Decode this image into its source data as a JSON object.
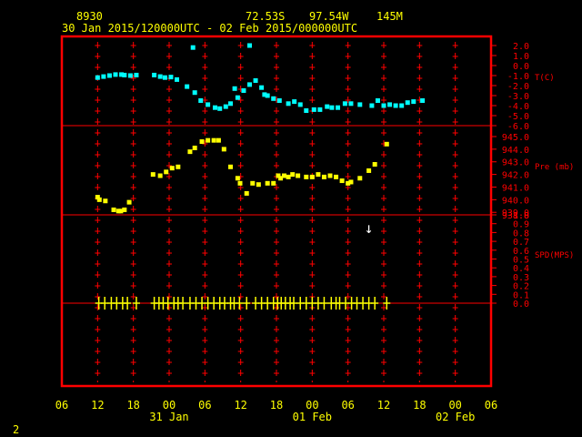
{
  "header": {
    "station_id": "8930",
    "latitude": "72.53S",
    "longitude": "97.54W",
    "elevation": "145M",
    "time_range": "30 Jan 2015/120000UTC - 02 Feb 2015/000000UTC"
  },
  "footer": {
    "page_number": "2",
    "time_tick_labels": [
      "06",
      "12",
      "18",
      "00",
      "06",
      "12",
      "18",
      "00",
      "06",
      "12",
      "18",
      "00",
      "06"
    ],
    "date_labels": [
      "31 Jan",
      "01 Feb",
      "02 Feb"
    ]
  },
  "colors": {
    "frame": "#ff0000",
    "temperature": "#00ffff",
    "pressure": "#ffff00",
    "wind": "#ffff00",
    "grid": "#ff0000",
    "wind_arrow": "#ffffff",
    "text": "#ffff00",
    "axis_text": "#ff0000"
  },
  "chart_data": {
    "type": "scatter",
    "x_axis": {
      "units": "hours since 30 Jan 2015 06 UTC",
      "range": [
        0,
        72
      ],
      "tick_labels": [
        "06",
        "12",
        "18",
        "00",
        "06",
        "12",
        "18",
        "00",
        "06",
        "12",
        "18",
        "00",
        "06"
      ]
    },
    "panels": [
      {
        "name": "temperature",
        "ylabel": "T(C)",
        "y_ticks": [
          "2.0",
          "1.0",
          "0.0",
          "-1.0",
          "-2.0",
          "-3.0",
          "-4.0",
          "-5.0",
          "-6.0"
        ],
        "ylim": [
          -6,
          2
        ],
        "points": [
          [
            6.0,
            -1.2
          ],
          [
            7.0,
            -1.1
          ],
          [
            8.0,
            -1.0
          ],
          [
            9.0,
            -0.9
          ],
          [
            10.0,
            -0.9
          ],
          [
            10.5,
            -0.95
          ],
          [
            11.5,
            -1.0
          ],
          [
            12.5,
            -0.95
          ],
          [
            15.5,
            -0.95
          ],
          [
            16.5,
            -1.1
          ],
          [
            17.3,
            -1.2
          ],
          [
            18.3,
            -1.15
          ],
          [
            19.3,
            -1.4
          ],
          [
            21.0,
            -2.1
          ],
          [
            22.3,
            -2.7
          ],
          [
            23.3,
            -3.5
          ],
          [
            24.5,
            -3.9
          ],
          [
            25.7,
            -4.2
          ],
          [
            26.5,
            -4.3
          ],
          [
            27.5,
            -4.1
          ],
          [
            28.3,
            -3.8
          ],
          [
            29.0,
            -2.3
          ],
          [
            29.5,
            -3.2
          ],
          [
            30.5,
            -2.5
          ],
          [
            31.5,
            -1.9
          ],
          [
            32.5,
            -1.5
          ],
          [
            33.5,
            -2.2
          ],
          [
            34.0,
            -2.9
          ],
          [
            34.5,
            -3.0
          ],
          [
            35.5,
            -3.3
          ],
          [
            36.5,
            -3.5
          ],
          [
            38.0,
            -3.8
          ],
          [
            39.0,
            -3.6
          ],
          [
            40.0,
            -3.9
          ],
          [
            41.0,
            -4.5
          ],
          [
            42.3,
            -4.4
          ],
          [
            43.3,
            -4.4
          ],
          [
            44.5,
            -4.1
          ],
          [
            45.3,
            -4.2
          ],
          [
            46.3,
            -4.2
          ],
          [
            47.5,
            -3.8
          ],
          [
            48.5,
            -3.8
          ],
          [
            50.0,
            -3.9
          ],
          [
            52.0,
            -4.0
          ],
          [
            53.0,
            -3.5
          ],
          [
            54.0,
            -4.0
          ],
          [
            55.0,
            -3.9
          ],
          [
            56.0,
            -4.0
          ],
          [
            57.0,
            -4.0
          ],
          [
            58.0,
            -3.7
          ],
          [
            59.0,
            -3.6
          ],
          [
            60.5,
            -3.5
          ],
          [
            22.0,
            1.8
          ],
          [
            31.5,
            2.0
          ]
        ]
      },
      {
        "name": "pressure",
        "ylabel": "Pre (mb)",
        "y_ticks": [
          "945.0",
          "944.0",
          "943.0",
          "942.0",
          "941.0",
          "940.0",
          "939.0",
          "938.8"
        ],
        "ylim": [
          938.8,
          945.0
        ],
        "points": [
          [
            6.0,
            940.2
          ],
          [
            6.3,
            940.0
          ],
          [
            7.3,
            939.9
          ],
          [
            8.7,
            939.2
          ],
          [
            9.5,
            939.1
          ],
          [
            9.9,
            939.1
          ],
          [
            10.5,
            939.2
          ],
          [
            11.3,
            939.8
          ],
          [
            15.3,
            942.0
          ],
          [
            16.5,
            941.9
          ],
          [
            17.5,
            942.2
          ],
          [
            18.5,
            942.5
          ],
          [
            19.5,
            942.6
          ],
          [
            21.5,
            943.8
          ],
          [
            22.3,
            944.1
          ],
          [
            23.5,
            944.6
          ],
          [
            24.5,
            944.7
          ],
          [
            25.5,
            944.7
          ],
          [
            26.3,
            944.7
          ],
          [
            27.2,
            944.0
          ],
          [
            28.3,
            942.6
          ],
          [
            29.5,
            941.7
          ],
          [
            29.9,
            941.3
          ],
          [
            31.0,
            940.5
          ],
          [
            32.0,
            941.3
          ],
          [
            33.0,
            941.2
          ],
          [
            34.5,
            941.3
          ],
          [
            35.5,
            941.3
          ],
          [
            36.3,
            941.9
          ],
          [
            36.7,
            941.7
          ],
          [
            37.3,
            941.9
          ],
          [
            38.0,
            941.8
          ],
          [
            38.7,
            942.0
          ],
          [
            39.6,
            941.9
          ],
          [
            41.0,
            941.8
          ],
          [
            42.0,
            941.8
          ],
          [
            43.0,
            942.0
          ],
          [
            44.0,
            941.8
          ],
          [
            45.0,
            941.9
          ],
          [
            46.0,
            941.8
          ],
          [
            47.0,
            941.5
          ],
          [
            48.0,
            941.3
          ],
          [
            48.5,
            941.4
          ],
          [
            50.0,
            941.7
          ],
          [
            51.5,
            942.3
          ],
          [
            52.5,
            942.8
          ],
          [
            54.5,
            944.4
          ]
        ]
      },
      {
        "name": "wind speed",
        "ylabel": "SPD(MPS)",
        "y_ticks": [
          "1.0",
          "0.9",
          "0.8",
          "0.7",
          "0.6",
          "0.5",
          "0.4",
          "0.3",
          "0.2",
          "0.1",
          "0.0"
        ],
        "ylim": [
          0,
          1.0
        ],
        "points": [
          [
            6.2,
            0
          ],
          [
            7.2,
            0
          ],
          [
            8.3,
            0
          ],
          [
            9.2,
            0
          ],
          [
            10.2,
            0
          ],
          [
            11.0,
            0
          ],
          [
            12.5,
            0
          ],
          [
            15.5,
            0
          ],
          [
            16.3,
            0
          ],
          [
            17.0,
            0
          ],
          [
            17.8,
            0
          ],
          [
            18.8,
            0
          ],
          [
            19.5,
            0
          ],
          [
            20.3,
            0
          ],
          [
            21.5,
            0
          ],
          [
            22.5,
            0
          ],
          [
            23.5,
            0
          ],
          [
            24.5,
            0
          ],
          [
            25.5,
            0
          ],
          [
            26.5,
            0
          ],
          [
            27.3,
            0
          ],
          [
            28.3,
            0
          ],
          [
            28.9,
            0
          ],
          [
            29.8,
            0
          ],
          [
            31.0,
            0
          ],
          [
            32.5,
            0
          ],
          [
            33.5,
            0
          ],
          [
            34.5,
            0
          ],
          [
            35.5,
            0
          ],
          [
            36.2,
            0
          ],
          [
            36.8,
            0
          ],
          [
            37.5,
            0
          ],
          [
            38.3,
            0
          ],
          [
            38.9,
            0
          ],
          [
            40.0,
            0
          ],
          [
            41.0,
            0
          ],
          [
            42.0,
            0
          ],
          [
            43.0,
            0
          ],
          [
            44.0,
            0
          ],
          [
            45.2,
            0
          ],
          [
            46.0,
            0
          ],
          [
            46.6,
            0
          ],
          [
            47.6,
            0
          ],
          [
            48.6,
            0
          ],
          [
            49.5,
            0
          ],
          [
            50.5,
            0
          ],
          [
            51.5,
            0
          ],
          [
            52.5,
            0
          ],
          [
            54.5,
            0
          ]
        ],
        "direction_arrow": {
          "x": 51.5,
          "label": "↓"
        }
      }
    ],
    "grid": "dashed vertical at 6-hourly ticks"
  }
}
